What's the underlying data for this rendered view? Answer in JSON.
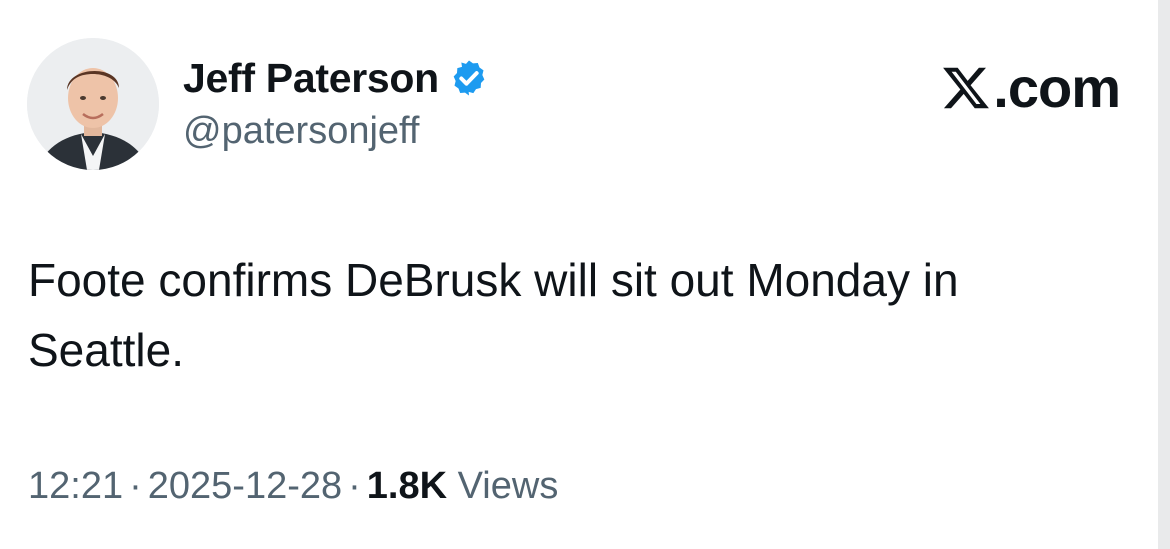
{
  "author": {
    "display_name": "Jeff Paterson",
    "handle": "@patersonjeff",
    "verified": true,
    "verified_icon": "verified-badge-icon",
    "verified_color": "#1d9bf0"
  },
  "brand": {
    "label": ".com",
    "logo_icon": "x-logo-icon"
  },
  "tweet": {
    "text": "Foote confirms DeBrusk will sit out Monday in Seattle."
  },
  "meta": {
    "time": "12:21",
    "separator": "·",
    "date": "2025-12-28",
    "views_count": "1.8K",
    "views_label": "Views"
  },
  "colors": {
    "text_primary": "#0f1419",
    "text_secondary": "#536471",
    "accent": "#1d9bf0"
  }
}
